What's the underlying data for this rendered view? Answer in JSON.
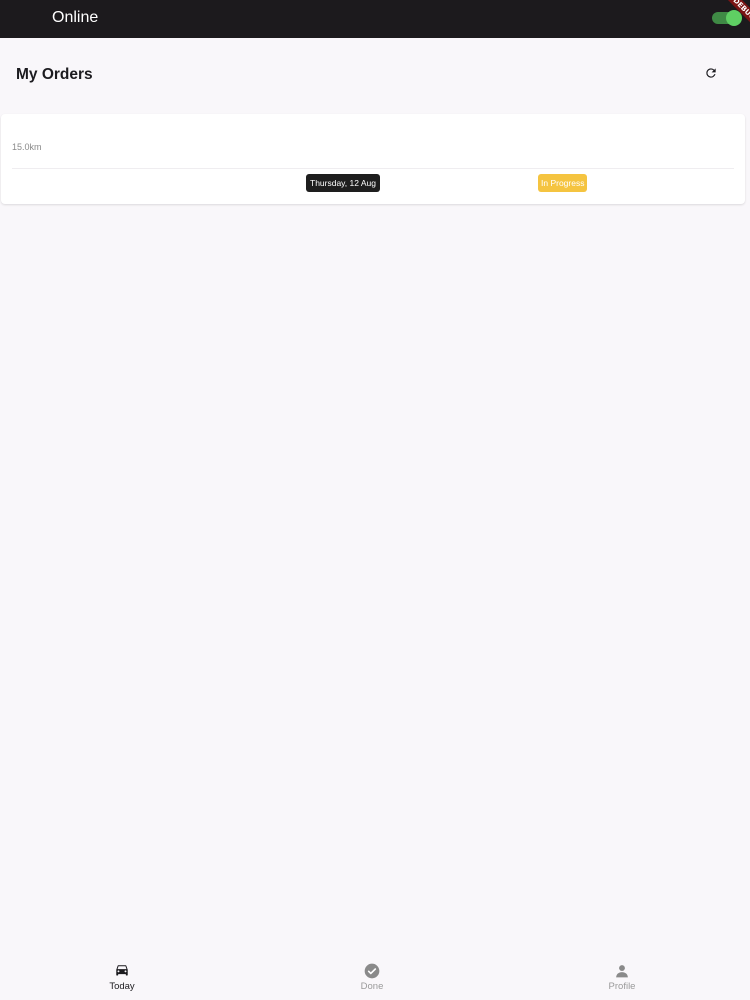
{
  "status_bar": {
    "status_text": "Online",
    "online_toggle_on": true,
    "debug_banner": "DEBUG"
  },
  "header": {
    "title": "My Orders",
    "refresh_icon": "refresh-icon"
  },
  "orders": [
    {
      "distance": "15.0km",
      "date": "Thursday, 12 Aug",
      "status": "In Progress"
    }
  ],
  "bottom_nav": {
    "items": [
      {
        "label": "Today",
        "icon": "car-icon",
        "active": true
      },
      {
        "label": "Done",
        "icon": "check-circle-icon",
        "active": false
      },
      {
        "label": "Profile",
        "icon": "person-icon",
        "active": false
      }
    ]
  },
  "colors": {
    "topbar_bg": "#1c1a1d",
    "toggle_on": "#5fcf63",
    "status_in_progress": "#f5c440",
    "date_badge_bg": "#1e1e1e",
    "page_bg": "#f9f7fa"
  }
}
